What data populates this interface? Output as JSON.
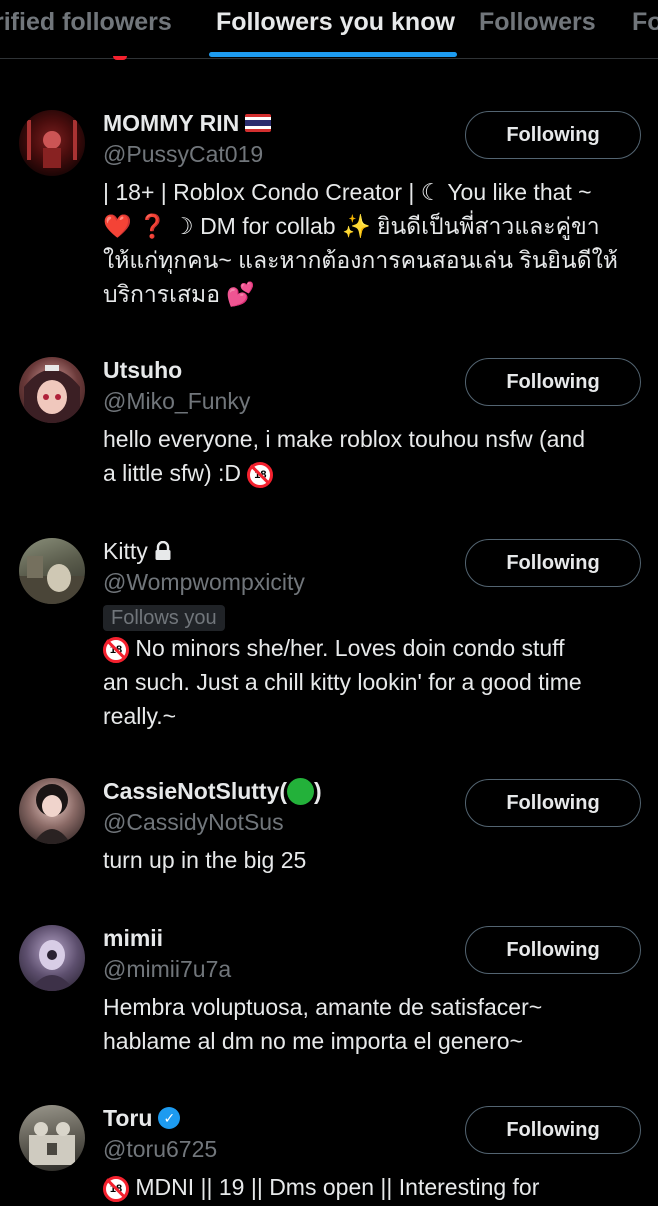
{
  "tabs": [
    {
      "label": "Verified followers",
      "visible_text": "rified followers",
      "active": false
    },
    {
      "label": "Followers you know",
      "active": true
    },
    {
      "label": "Followers",
      "active": false
    },
    {
      "label": "Following",
      "visible_text": "Fo",
      "active": false
    }
  ],
  "colors": {
    "background": "#000000",
    "primary_text": "#e7e9ea",
    "secondary_text": "#71767b",
    "accent": "#1d9bf0",
    "button_border": "#536471",
    "divider": "#2f3336"
  },
  "users": [
    {
      "name": "MOMMY RIN",
      "name_suffix_icon": "thailand-flag-icon",
      "handle": "@PussyCat019",
      "button": "Following",
      "bio": [
        "| 18+ | Roblox Condo Creator | ☾ You like that ~",
        "❤️ ❓ ☽ DM for collab ✨ ยินดีเป็นพี่สาวและคู่ขา",
        "ให้แก่ทุกคน~ และหากต้องการคนสอนเล่น รินยินดีให้",
        "บริการเสมอ 💕"
      ]
    },
    {
      "name": "Utsuho",
      "handle": "@Miko_Funky",
      "button": "Following",
      "bio": [
        "hello everyone, i make roblox touhou nsfw (and",
        "a little sfw) :D"
      ],
      "bio_trailing_icon": "no-under-18-icon"
    },
    {
      "name": "Kitty",
      "name_suffix_icon": "lock-icon",
      "handle": "@Wompwompxicity",
      "badge": "Follows you",
      "button": "Following",
      "bio": [
        "No minors she/her. Loves doin condo stuff",
        "an such. Just a chill kitty lookin' for a good time",
        "really.~"
      ],
      "bio_leading_icon": "no-under-18-icon"
    },
    {
      "name_prefix": "CassieNotSlutty(",
      "name_suffix": ")",
      "name_inner_icon": "green-circle-icon",
      "handle": "@CassidyNotSus",
      "button": "Following",
      "bio": [
        "turn up in the big 25"
      ]
    },
    {
      "name": "mimii",
      "handle": "@mimii7u7a",
      "button": "Following",
      "bio": [
        "Hembra voluptuosa, amante de satisfacer~",
        "hablame al dm no me importa el genero~"
      ]
    },
    {
      "name": "Toru",
      "name_suffix_icon": "verified-badge-icon",
      "handle": "@toru6725",
      "button": "Following",
      "bio": [
        "MDNI || 19 || Dms open || Interesting for"
      ],
      "bio_leading_icon": "no-under-18-icon"
    }
  ]
}
